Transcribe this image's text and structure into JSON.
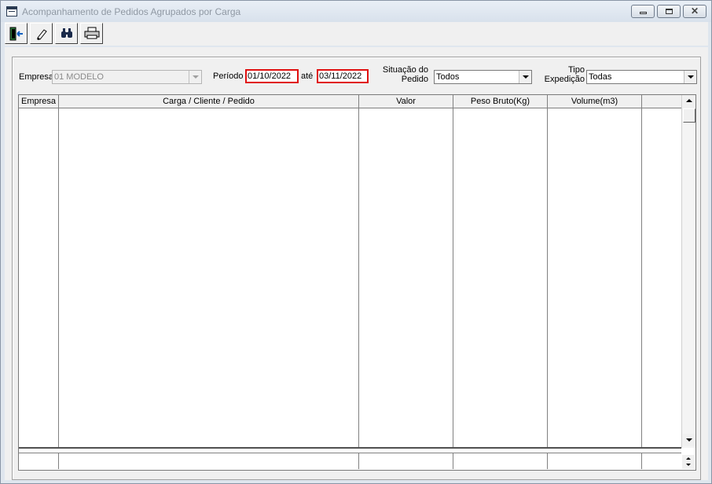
{
  "window": {
    "title": "Acompanhamento de Pedidos Agrupados por Carga",
    "controls": {
      "minimize": "minimize",
      "maximize": "maximize",
      "close": "close"
    }
  },
  "toolbar": {
    "buttons": [
      {
        "icon": "exit-door-icon"
      },
      {
        "icon": "eraser-icon"
      },
      {
        "icon": "binoculars-icon"
      },
      {
        "icon": "printer-icon"
      }
    ]
  },
  "filters": {
    "empresa_label": "Empresa",
    "empresa_value": "01 MODELO",
    "periodo_label": "Período",
    "date_from": "01/10/2022",
    "ate_label": "até",
    "date_to": "03/11/2022",
    "situacao_label_1": "Situação do",
    "situacao_label_2": "Pedido",
    "situacao_value": "Todos",
    "tipo_label_1": "Tipo",
    "tipo_label_2": "Expedição",
    "tipo_value": "Todas"
  },
  "grid": {
    "columns": [
      "Empresa",
      "Carga / Cliente / Pedido",
      "Valor",
      "Peso Bruto(Kg)",
      "Volume(m3)",
      ""
    ],
    "rows": []
  },
  "colors": {
    "date_border": "#e01010",
    "disabled_text": "#8a8a8a"
  }
}
